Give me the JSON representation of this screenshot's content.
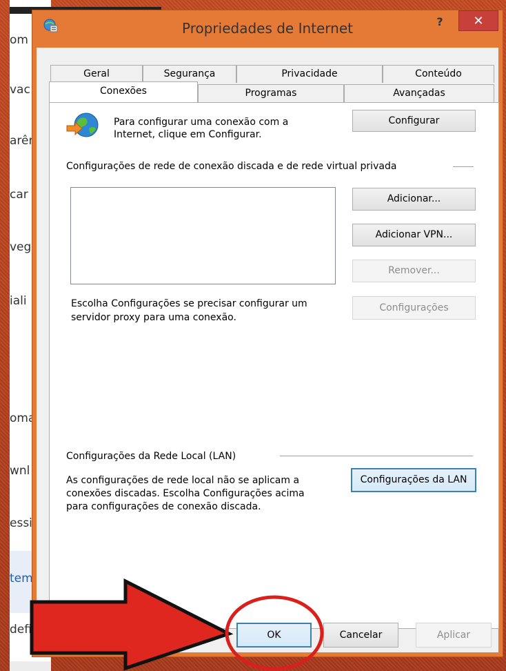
{
  "behind_window": {
    "fragments": [
      "om",
      "vac",
      "arên",
      "car",
      "veg",
      "iali",
      "oma",
      "wnl",
      "essi",
      "tem",
      "defi"
    ]
  },
  "dialog": {
    "title": "Propriedades de Internet",
    "help_label": "?",
    "close_label": "✕",
    "tabs_row1": [
      "Geral",
      "Segurança",
      "Privacidade",
      "Conteúdo"
    ],
    "tabs_row2": [
      "Conexões",
      "Programas",
      "Avançadas"
    ],
    "active_tab": "Conexões",
    "setup_text": "Para configurar uma conexão com a Internet, clique em Configurar.",
    "setup_line1": "Para configurar uma conexão com a",
    "setup_line2": "Internet, clique em Configurar.",
    "configure_button": "Configurar",
    "dialup_section_label": "Configurações de rede de conexão discada e de rede virtual privada",
    "add_button": "Adicionar...",
    "add_vpn_button": "Adicionar VPN...",
    "remove_button": "Remover...",
    "settings_button": "Configurações",
    "proxy_line1": "Escolha Configurações se precisar configurar um",
    "proxy_line2": "servidor proxy para uma conexão.",
    "lan_section_label": "Configurações da Rede Local (LAN)",
    "lan_line1": "As configurações de rede local não se aplicam a",
    "lan_line2": "conexões discadas. Escolha Configurações acima",
    "lan_line3": "para configurações de conexão discada.",
    "lan_button": "Configurações da LAN",
    "ok_button": "OK",
    "cancel_button": "Cancelar",
    "apply_button": "Aplicar"
  },
  "colors": {
    "frame": "#b3421f",
    "dialog_border": "#e57a36",
    "close": "#c7403a",
    "annotation": "#e0271f"
  }
}
